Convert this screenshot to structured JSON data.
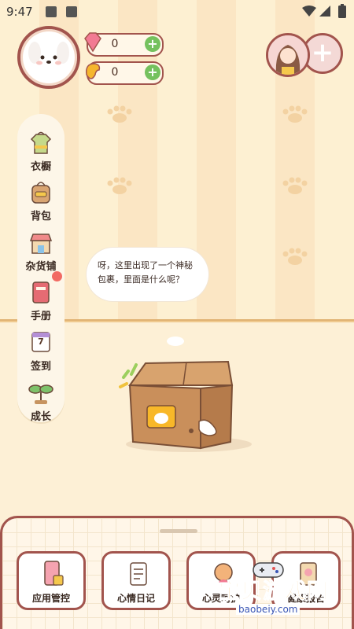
{
  "status_bar": {
    "time": "9:47"
  },
  "currency": {
    "gems": "0",
    "coins": "0"
  },
  "side_menu": {
    "items": [
      {
        "label": "衣橱"
      },
      {
        "label": "背包"
      },
      {
        "label": "杂货铺"
      },
      {
        "label": "手册"
      },
      {
        "label": "签到"
      },
      {
        "label": "成长"
      }
    ],
    "calendar_day": "7"
  },
  "speech_bubble": {
    "text": "呀，这里出现了一个神秘包裹，里面是什么呢？"
  },
  "bottom_panel": {
    "tiles": [
      {
        "label": "应用管控"
      },
      {
        "label": "心情日记"
      },
      {
        "label": "心灵呵护"
      },
      {
        "label": "健康报告"
      }
    ]
  },
  "watermark": {
    "title": "宝贝游戏网",
    "url": "baobeiy.com"
  },
  "colors": {
    "accent_border": "#a2544d",
    "plus_green": "#75c15e",
    "notification_red": "#f26a63",
    "wall_light": "#fdf0d2",
    "wall_dark": "#fbe6c4"
  }
}
